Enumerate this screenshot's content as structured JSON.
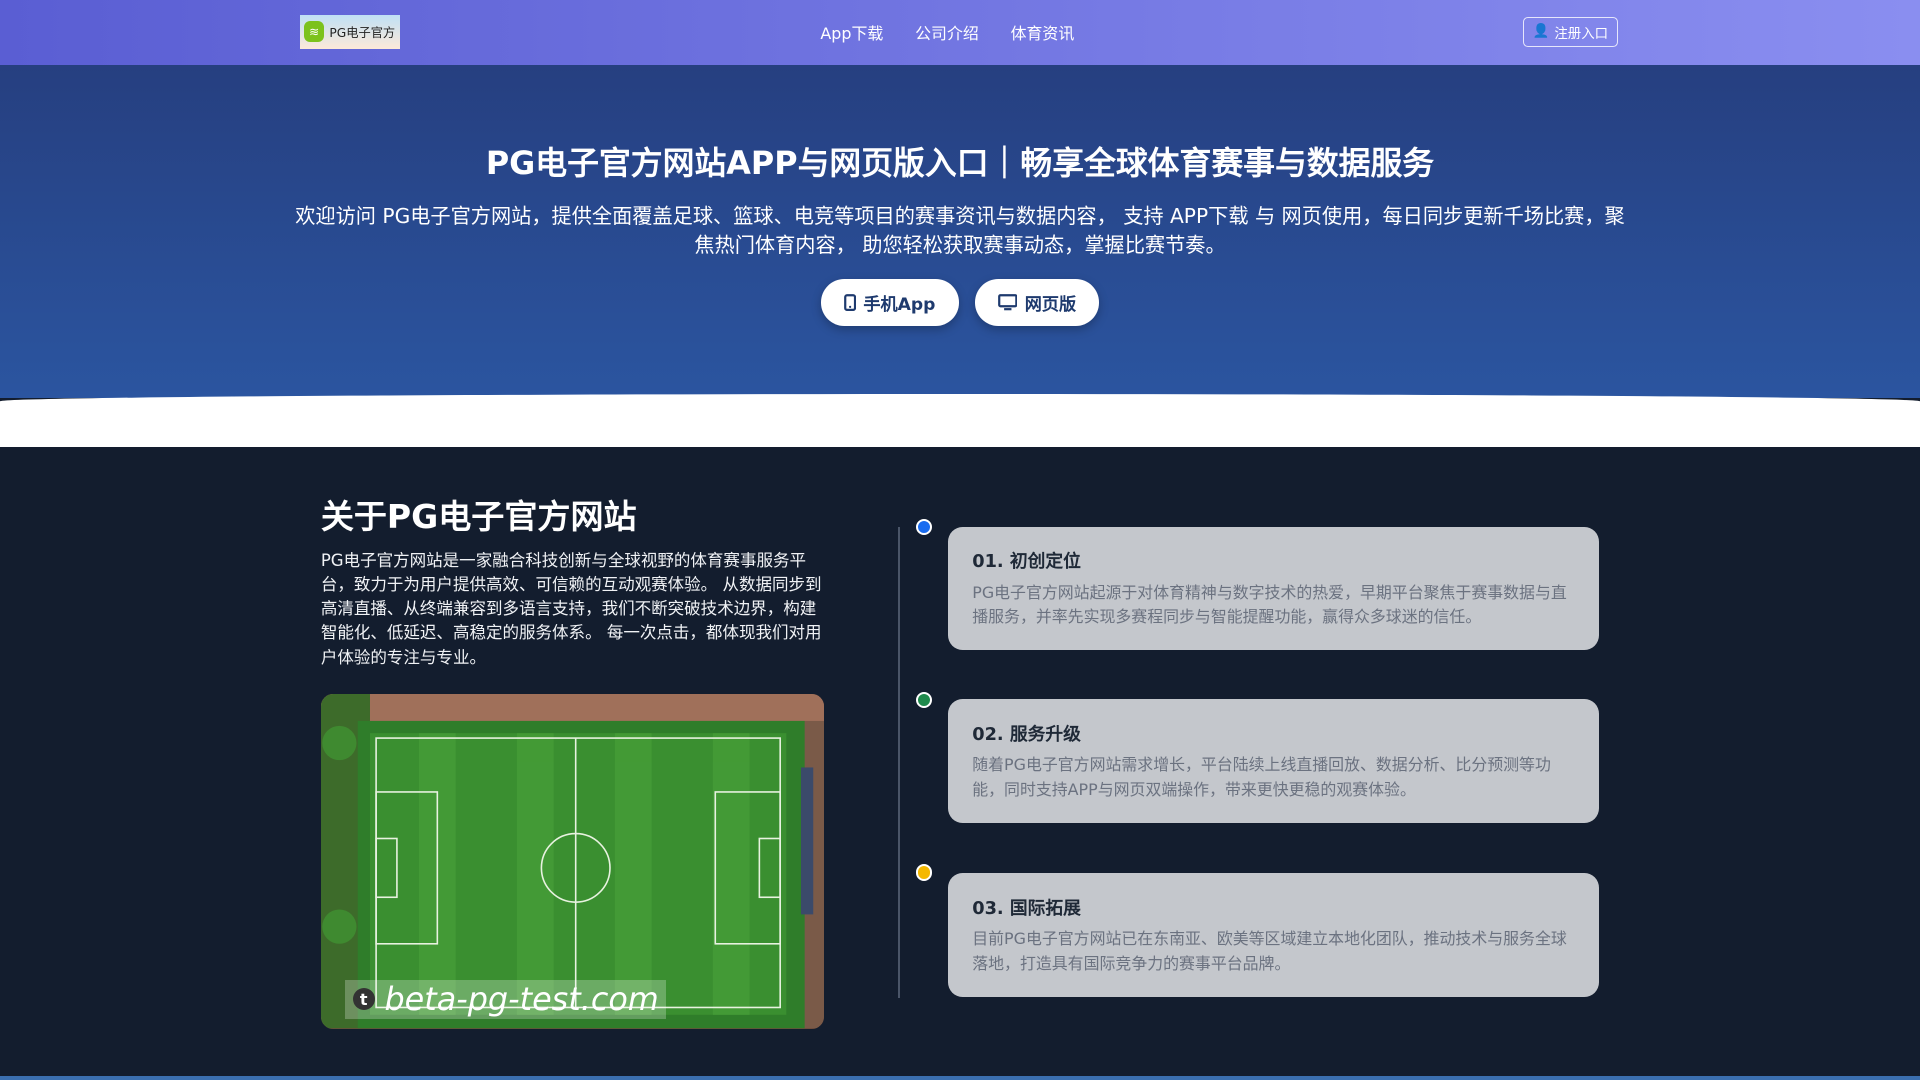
{
  "nav": {
    "logo_text": "PG电子官方",
    "links": [
      "App下载",
      "公司介绍",
      "体育资讯"
    ],
    "register": "注册入口"
  },
  "hero": {
    "title": "PG电子官方网站APP与网页版入口｜畅享全球体育赛事与数据服务",
    "description": "欢迎访问 PG电子官方网站，提供全面覆盖足球、篮球、电竞等项目的赛事资讯与数据内容， 支持 APP下载 与 网页使用，每日同步更新千场比赛，聚焦热门体育内容， 助您轻松获取赛事动态，掌握比赛节奏。",
    "btn_app": "手机App",
    "btn_web": "网页版"
  },
  "about": {
    "title": "关于PG电子官方网站",
    "text": "PG电子官方网站是一家融合科技创新与全球视野的体育赛事服务平台，致力于为用户提供高效、可信赖的互动观赛体验。 从数据同步到高清直播、从终端兼容到多语言支持，我们不断突破技术边界，构建智能化、低延迟、高稳定的服务体系。 每一次点击，都体现我们对用户体验的专注与专业。",
    "watermark": "beta-pg-test.com"
  },
  "timeline": [
    {
      "title": "01. 初创定位",
      "text": "PG电子官方网站起源于对体育精神与数字技术的热爱，早期平台聚焦于赛事数据与直播服务，并率先实现多赛程同步与智能提醒功能，赢得众多球迷的信任。",
      "color": "#1a6cf0"
    },
    {
      "title": "02. 服务升级",
      "text": "随着PG电子官方网站需求增长，平台陆续上线直播回放、数据分析、比分预测等功能，同时支持APP与网页双端操作，带来更快更稳的观赛体验。",
      "color": "#1f8a4c"
    },
    {
      "title": "03. 国际拓展",
      "text": "目前PG电子官方网站已在东南亚、欧美等区域建立本地化团队，推动技术与服务全球落地，打造具有国际竞争力的赛事平台品牌。",
      "color": "#f5b800"
    }
  ]
}
